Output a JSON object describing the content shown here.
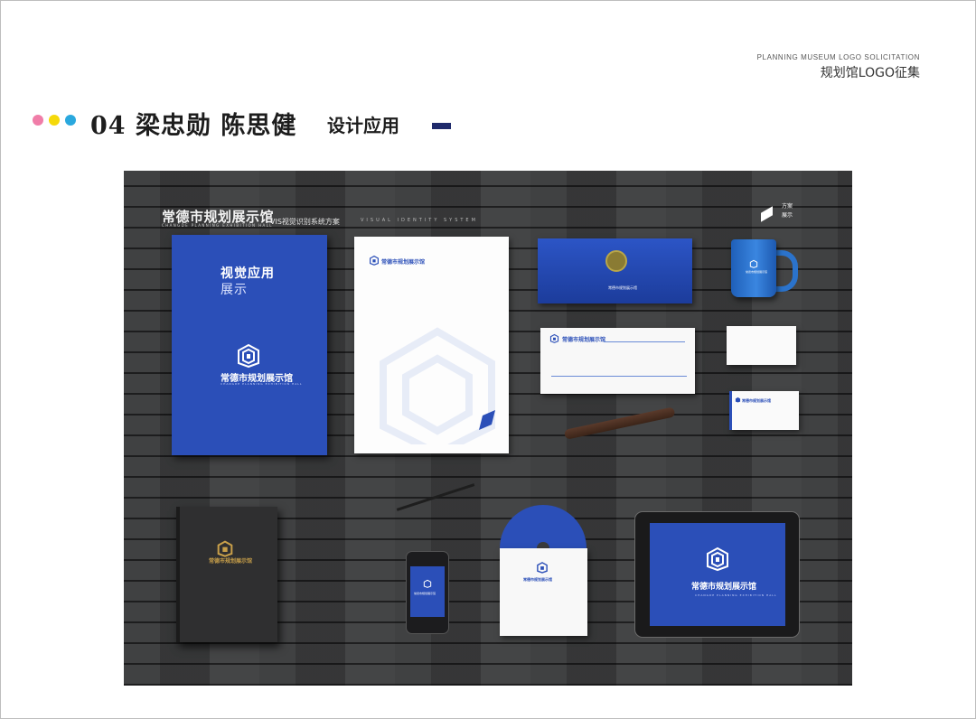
{
  "header": {
    "en": "PLANNING MUSEUM LOGO SOLICITATION",
    "cn": "规划馆LOGO征集"
  },
  "title": {
    "main": "04 梁忠勋 陈思健",
    "sub": "设计应用"
  },
  "colors": {
    "dot1": "#f07da8",
    "dot2": "#f5d90a",
    "dot3": "#2aa8de",
    "accent": "#1f2a6b",
    "brand_blue": "#2b4fb8"
  },
  "scene": {
    "brand_cn": "常德市规划展示馆",
    "brand_en": "CHANGDE PLANNING EXHIBITION HALL",
    "vis_label": "VIS视觉识别系统方案",
    "vis_en": "VISUAL IDENTITY SYSTEM",
    "corner_line1": "方案",
    "corner_line2": "展示",
    "folder_title": "视觉应用",
    "folder_subtitle": "展示"
  }
}
